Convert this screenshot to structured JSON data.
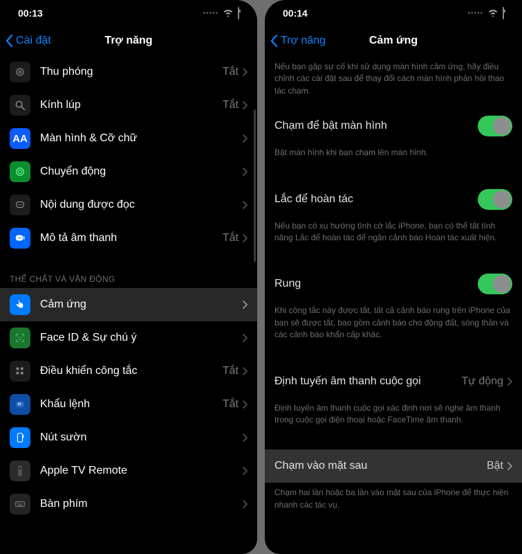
{
  "left": {
    "status_time": "00:13",
    "back_label": "Cài đặt",
    "title": "Trợ năng",
    "value_off": "Tắt",
    "section_physical": "THỂ CHẤT VÀ VẬN ĐỘNG",
    "rows": {
      "zoom": {
        "label": "Thu phóng",
        "value": "Tắt"
      },
      "magnifier": {
        "label": "Kính lúp",
        "value": "Tắt"
      },
      "display": {
        "label": "Màn hình & Cỡ chữ"
      },
      "motion": {
        "label": "Chuyển động"
      },
      "spoken": {
        "label": "Nội dung được đọc"
      },
      "audio_desc": {
        "label": "Mô tả âm thanh",
        "value": "Tắt"
      },
      "touch": {
        "label": "Cảm ứng"
      },
      "faceid": {
        "label": "Face ID & Sự chú ý"
      },
      "switch_ctrl": {
        "label": "Điều khiển công tắc",
        "value": "Tắt"
      },
      "voice_ctrl": {
        "label": "Khẩu lệnh",
        "value": "Tắt"
      },
      "side_button": {
        "label": "Nút sườn"
      },
      "appletv": {
        "label": "Apple TV Remote"
      },
      "keyboard": {
        "label": "Bàn phím"
      }
    }
  },
  "right": {
    "status_time": "00:14",
    "back_label": "Trợ năng",
    "title": "Cảm ứng",
    "intro": "Nếu bạn gặp sự cố khi sử dụng màn hình cảm ứng, hãy điều chỉnh các cài đặt sau để thay đổi cách màn hình phản hồi thao tác chạm.",
    "rows": {
      "tap_wake": {
        "label": "Chạm để bật màn hình",
        "footer": "Bật màn hình khi bạn chạm lên màn hình."
      },
      "shake_undo": {
        "label": "Lắc để hoàn tác",
        "footer": "Nếu bạn có xu hướng tình cờ lắc iPhone, bạn có thể tắt tính năng Lắc để hoàn tác để ngăn cảnh báo Hoàn tác xuất hiện."
      },
      "vibration": {
        "label": "Rung",
        "footer": "Khi công tắc này được tắt, tất cả cảnh báo rung trên iPhone của bạn sẽ được tắt, bao gồm cảnh báo cho động đất, sóng thần và các cảnh báo khẩn cấp khác."
      },
      "audio_route": {
        "label": "Định tuyến âm thanh cuộc gọi",
        "value": "Tự động",
        "footer": "Định tuyến âm thanh cuộc gọi xác định nơi sẽ nghe âm thanh trong cuộc gọi điện thoại hoặc FaceTime âm thanh."
      },
      "back_tap": {
        "label": "Chạm vào mặt sau",
        "value": "Bật",
        "footer": "Chạm hai lần hoặc ba lần vào mặt sau của iPhone để thực hiện nhanh các tác vụ."
      }
    }
  }
}
